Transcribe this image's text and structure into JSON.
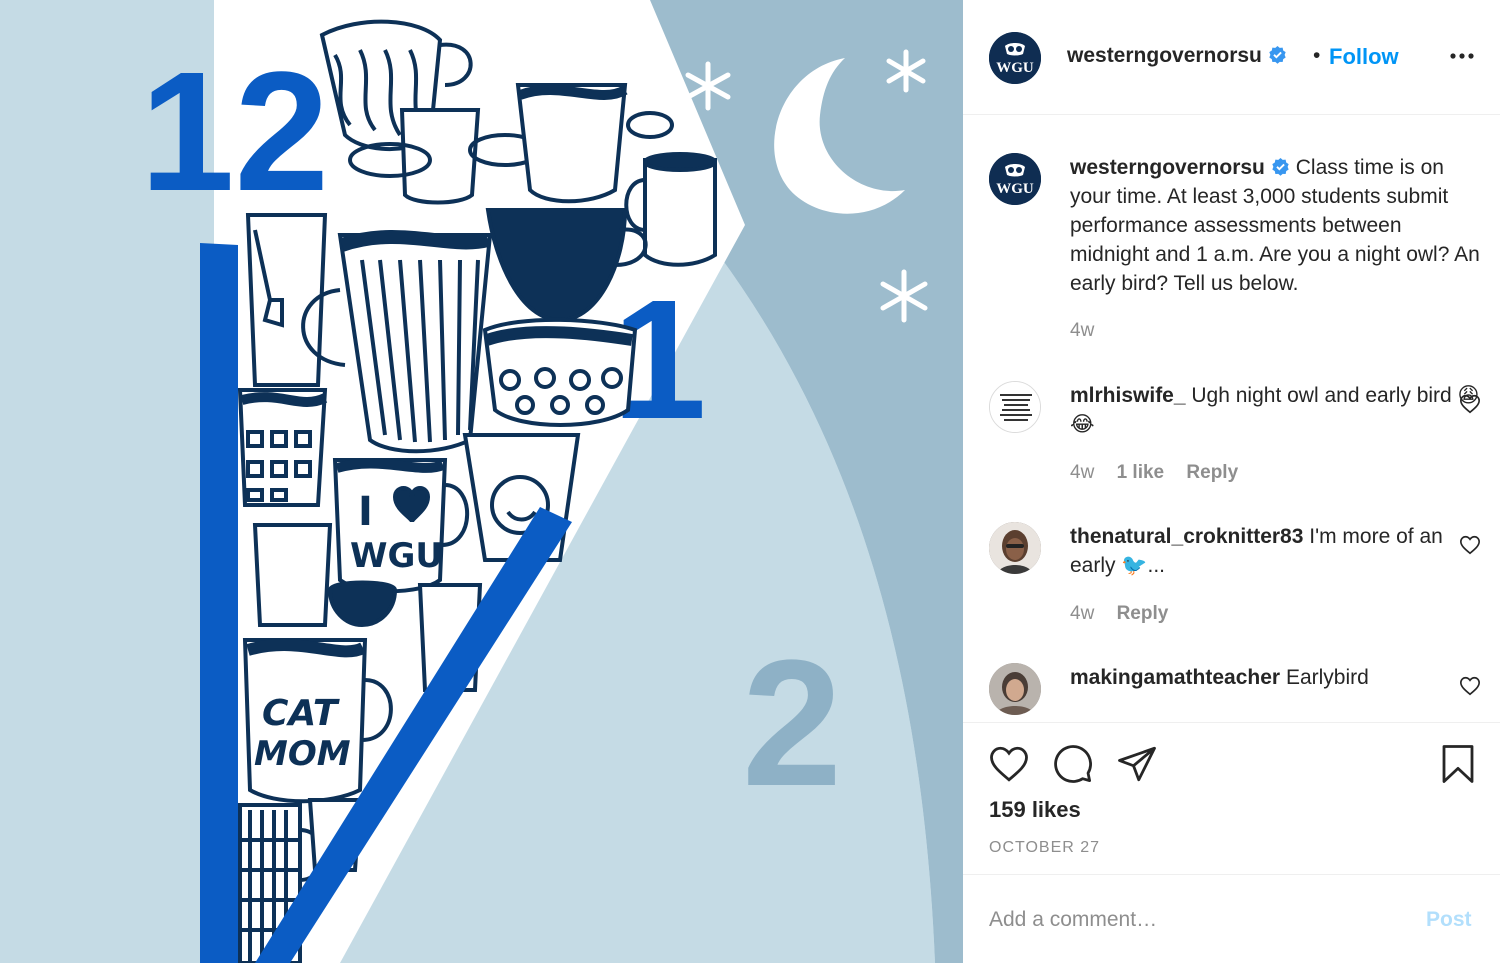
{
  "image": {
    "numerals": [
      "12",
      "1",
      "2"
    ],
    "mug_texts": [
      "I",
      "WGU",
      "CAT",
      "MOM"
    ],
    "colors": {
      "sky": "#9dbccd",
      "clock_face": "#c5dbe5",
      "hand": "#0b5cc4",
      "navy": "#0d3157",
      "paper": "#ffffff"
    }
  },
  "header": {
    "avatar_text": "WGU",
    "username": "westerngovernorsu",
    "separator": "•",
    "follow": "Follow",
    "more_icon": "more-dots-icon"
  },
  "caption": {
    "avatar_text": "WGU",
    "username": "westerngovernorsu",
    "text": "Class time is on your time. At least 3,000 students submit performance assessments between midnight and 1 a.m. Are you a night owl? An early bird? Tell us below.",
    "age": "4w"
  },
  "comments": [
    {
      "username": "mlrhiswife_",
      "text": "Ugh night owl and early bird 😩😂",
      "age": "4w",
      "likes": "1 like",
      "reply": "Reply",
      "avatar_text": "WORK HARD IN SILENCE. LET YOUR SUCCESS BE YOUR NOISE."
    },
    {
      "username": "thenatural_croknitter83",
      "text": "I'm more of an early 🐦...",
      "age": "4w",
      "reply": "Reply"
    },
    {
      "username": "makingamathteacher",
      "text": "Earlybird"
    }
  ],
  "actions": {
    "like_icon": "heart-icon",
    "comment_icon": "comment-bubble-icon",
    "share_icon": "paper-plane-icon",
    "save_icon": "bookmark-icon"
  },
  "likes": "159 likes",
  "date": "OCTOBER 27",
  "add_comment": {
    "placeholder": "Add a comment…",
    "post": "Post"
  },
  "colors": {
    "link_blue": "#0095f6",
    "post_disabled": "#b2dffc",
    "secondary_text": "#8e8e8e",
    "verified_blue": "#3897f0"
  }
}
